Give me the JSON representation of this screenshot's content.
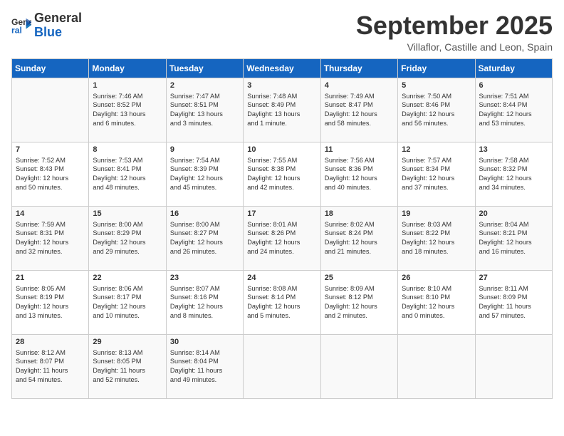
{
  "logo": {
    "line1": "General",
    "line2": "Blue"
  },
  "title": "September 2025",
  "subtitle": "Villaflor, Castille and Leon, Spain",
  "days_of_week": [
    "Sunday",
    "Monday",
    "Tuesday",
    "Wednesday",
    "Thursday",
    "Friday",
    "Saturday"
  ],
  "weeks": [
    [
      {
        "day": "",
        "content": ""
      },
      {
        "day": "1",
        "content": "Sunrise: 7:46 AM\nSunset: 8:52 PM\nDaylight: 13 hours\nand 6 minutes."
      },
      {
        "day": "2",
        "content": "Sunrise: 7:47 AM\nSunset: 8:51 PM\nDaylight: 13 hours\nand 3 minutes."
      },
      {
        "day": "3",
        "content": "Sunrise: 7:48 AM\nSunset: 8:49 PM\nDaylight: 13 hours\nand 1 minute."
      },
      {
        "day": "4",
        "content": "Sunrise: 7:49 AM\nSunset: 8:47 PM\nDaylight: 12 hours\nand 58 minutes."
      },
      {
        "day": "5",
        "content": "Sunrise: 7:50 AM\nSunset: 8:46 PM\nDaylight: 12 hours\nand 56 minutes."
      },
      {
        "day": "6",
        "content": "Sunrise: 7:51 AM\nSunset: 8:44 PM\nDaylight: 12 hours\nand 53 minutes."
      }
    ],
    [
      {
        "day": "7",
        "content": "Sunrise: 7:52 AM\nSunset: 8:43 PM\nDaylight: 12 hours\nand 50 minutes."
      },
      {
        "day": "8",
        "content": "Sunrise: 7:53 AM\nSunset: 8:41 PM\nDaylight: 12 hours\nand 48 minutes."
      },
      {
        "day": "9",
        "content": "Sunrise: 7:54 AM\nSunset: 8:39 PM\nDaylight: 12 hours\nand 45 minutes."
      },
      {
        "day": "10",
        "content": "Sunrise: 7:55 AM\nSunset: 8:38 PM\nDaylight: 12 hours\nand 42 minutes."
      },
      {
        "day": "11",
        "content": "Sunrise: 7:56 AM\nSunset: 8:36 PM\nDaylight: 12 hours\nand 40 minutes."
      },
      {
        "day": "12",
        "content": "Sunrise: 7:57 AM\nSunset: 8:34 PM\nDaylight: 12 hours\nand 37 minutes."
      },
      {
        "day": "13",
        "content": "Sunrise: 7:58 AM\nSunset: 8:32 PM\nDaylight: 12 hours\nand 34 minutes."
      }
    ],
    [
      {
        "day": "14",
        "content": "Sunrise: 7:59 AM\nSunset: 8:31 PM\nDaylight: 12 hours\nand 32 minutes."
      },
      {
        "day": "15",
        "content": "Sunrise: 8:00 AM\nSunset: 8:29 PM\nDaylight: 12 hours\nand 29 minutes."
      },
      {
        "day": "16",
        "content": "Sunrise: 8:00 AM\nSunset: 8:27 PM\nDaylight: 12 hours\nand 26 minutes."
      },
      {
        "day": "17",
        "content": "Sunrise: 8:01 AM\nSunset: 8:26 PM\nDaylight: 12 hours\nand 24 minutes."
      },
      {
        "day": "18",
        "content": "Sunrise: 8:02 AM\nSunset: 8:24 PM\nDaylight: 12 hours\nand 21 minutes."
      },
      {
        "day": "19",
        "content": "Sunrise: 8:03 AM\nSunset: 8:22 PM\nDaylight: 12 hours\nand 18 minutes."
      },
      {
        "day": "20",
        "content": "Sunrise: 8:04 AM\nSunset: 8:21 PM\nDaylight: 12 hours\nand 16 minutes."
      }
    ],
    [
      {
        "day": "21",
        "content": "Sunrise: 8:05 AM\nSunset: 8:19 PM\nDaylight: 12 hours\nand 13 minutes."
      },
      {
        "day": "22",
        "content": "Sunrise: 8:06 AM\nSunset: 8:17 PM\nDaylight: 12 hours\nand 10 minutes."
      },
      {
        "day": "23",
        "content": "Sunrise: 8:07 AM\nSunset: 8:16 PM\nDaylight: 12 hours\nand 8 minutes."
      },
      {
        "day": "24",
        "content": "Sunrise: 8:08 AM\nSunset: 8:14 PM\nDaylight: 12 hours\nand 5 minutes."
      },
      {
        "day": "25",
        "content": "Sunrise: 8:09 AM\nSunset: 8:12 PM\nDaylight: 12 hours\nand 2 minutes."
      },
      {
        "day": "26",
        "content": "Sunrise: 8:10 AM\nSunset: 8:10 PM\nDaylight: 12 hours\nand 0 minutes."
      },
      {
        "day": "27",
        "content": "Sunrise: 8:11 AM\nSunset: 8:09 PM\nDaylight: 11 hours\nand 57 minutes."
      }
    ],
    [
      {
        "day": "28",
        "content": "Sunrise: 8:12 AM\nSunset: 8:07 PM\nDaylight: 11 hours\nand 54 minutes."
      },
      {
        "day": "29",
        "content": "Sunrise: 8:13 AM\nSunset: 8:05 PM\nDaylight: 11 hours\nand 52 minutes."
      },
      {
        "day": "30",
        "content": "Sunrise: 8:14 AM\nSunset: 8:04 PM\nDaylight: 11 hours\nand 49 minutes."
      },
      {
        "day": "",
        "content": ""
      },
      {
        "day": "",
        "content": ""
      },
      {
        "day": "",
        "content": ""
      },
      {
        "day": "",
        "content": ""
      }
    ]
  ]
}
